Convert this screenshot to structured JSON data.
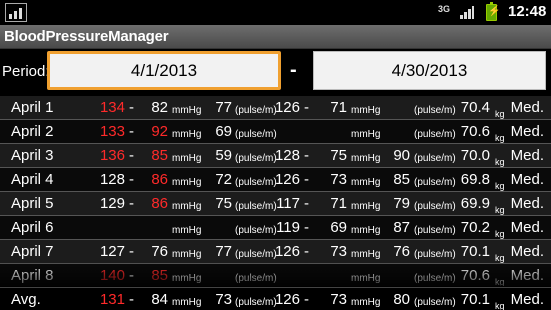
{
  "status_bar": {
    "network": "3G",
    "time": "12:48"
  },
  "app_title": "BloodPressureManager",
  "period": {
    "label": "Period:",
    "from": "4/1/2013",
    "separator": "-",
    "to": "4/30/2013"
  },
  "units": {
    "pressure": "mmHg",
    "pulse": "(pulse/m)",
    "weight": "kg"
  },
  "rows": [
    {
      "label": "April 1",
      "sys1": "134",
      "sys1_red": true,
      "dia1": "82",
      "dia1_red": false,
      "pulse1": "77",
      "sys2": "126",
      "dia2": "71",
      "pulse2": "",
      "weight": "70.4",
      "note": "Med."
    },
    {
      "label": "April 2",
      "sys1": "133",
      "sys1_red": true,
      "dia1": "92",
      "dia1_red": true,
      "pulse1": "69",
      "sys2": "",
      "dia2": "",
      "pulse2": "",
      "weight": "70.6",
      "note": "Med."
    },
    {
      "label": "April 3",
      "sys1": "136",
      "sys1_red": true,
      "dia1": "85",
      "dia1_red": true,
      "pulse1": "59",
      "sys2": "128",
      "dia2": "75",
      "pulse2": "90",
      "weight": "70.0",
      "note": "Med."
    },
    {
      "label": "April 4",
      "sys1": "128",
      "sys1_red": false,
      "dia1": "86",
      "dia1_red": true,
      "pulse1": "72",
      "sys2": "126",
      "dia2": "73",
      "pulse2": "85",
      "weight": "69.8",
      "note": "Med."
    },
    {
      "label": "April 5",
      "sys1": "129",
      "sys1_red": false,
      "dia1": "86",
      "dia1_red": true,
      "pulse1": "75",
      "sys2": "117",
      "dia2": "71",
      "pulse2": "79",
      "weight": "69.9",
      "note": "Med."
    },
    {
      "label": "April 6",
      "sys1": "",
      "sys1_red": false,
      "dia1": "",
      "dia1_red": false,
      "pulse1": "",
      "sys2": "119",
      "dia2": "69",
      "pulse2": "87",
      "weight": "70.2",
      "note": "Med."
    },
    {
      "label": "April 7",
      "sys1": "127",
      "sys1_red": false,
      "dia1": "76",
      "dia1_red": false,
      "pulse1": "77",
      "sys2": "126",
      "dia2": "73",
      "pulse2": "76",
      "weight": "70.1",
      "note": "Med."
    },
    {
      "label": "April 8",
      "sys1": "140",
      "sys1_red": true,
      "dia1": "85",
      "dia1_red": true,
      "pulse1": "",
      "sys2": "",
      "dia2": "",
      "pulse2": "",
      "weight": "70.6",
      "note": "Med."
    }
  ],
  "average": {
    "label": "Avg.",
    "sys1": "131",
    "sys1_red": true,
    "dia1": "84",
    "dia1_red": false,
    "pulse1": "73",
    "sys2": "126",
    "dia2": "73",
    "pulse2": "80",
    "weight": "70.1",
    "note": "Med."
  },
  "colors": {
    "accent_orange": "#f0a030",
    "alert_red": "#ff2a2a",
    "title_bar": "#5a5a5a"
  }
}
